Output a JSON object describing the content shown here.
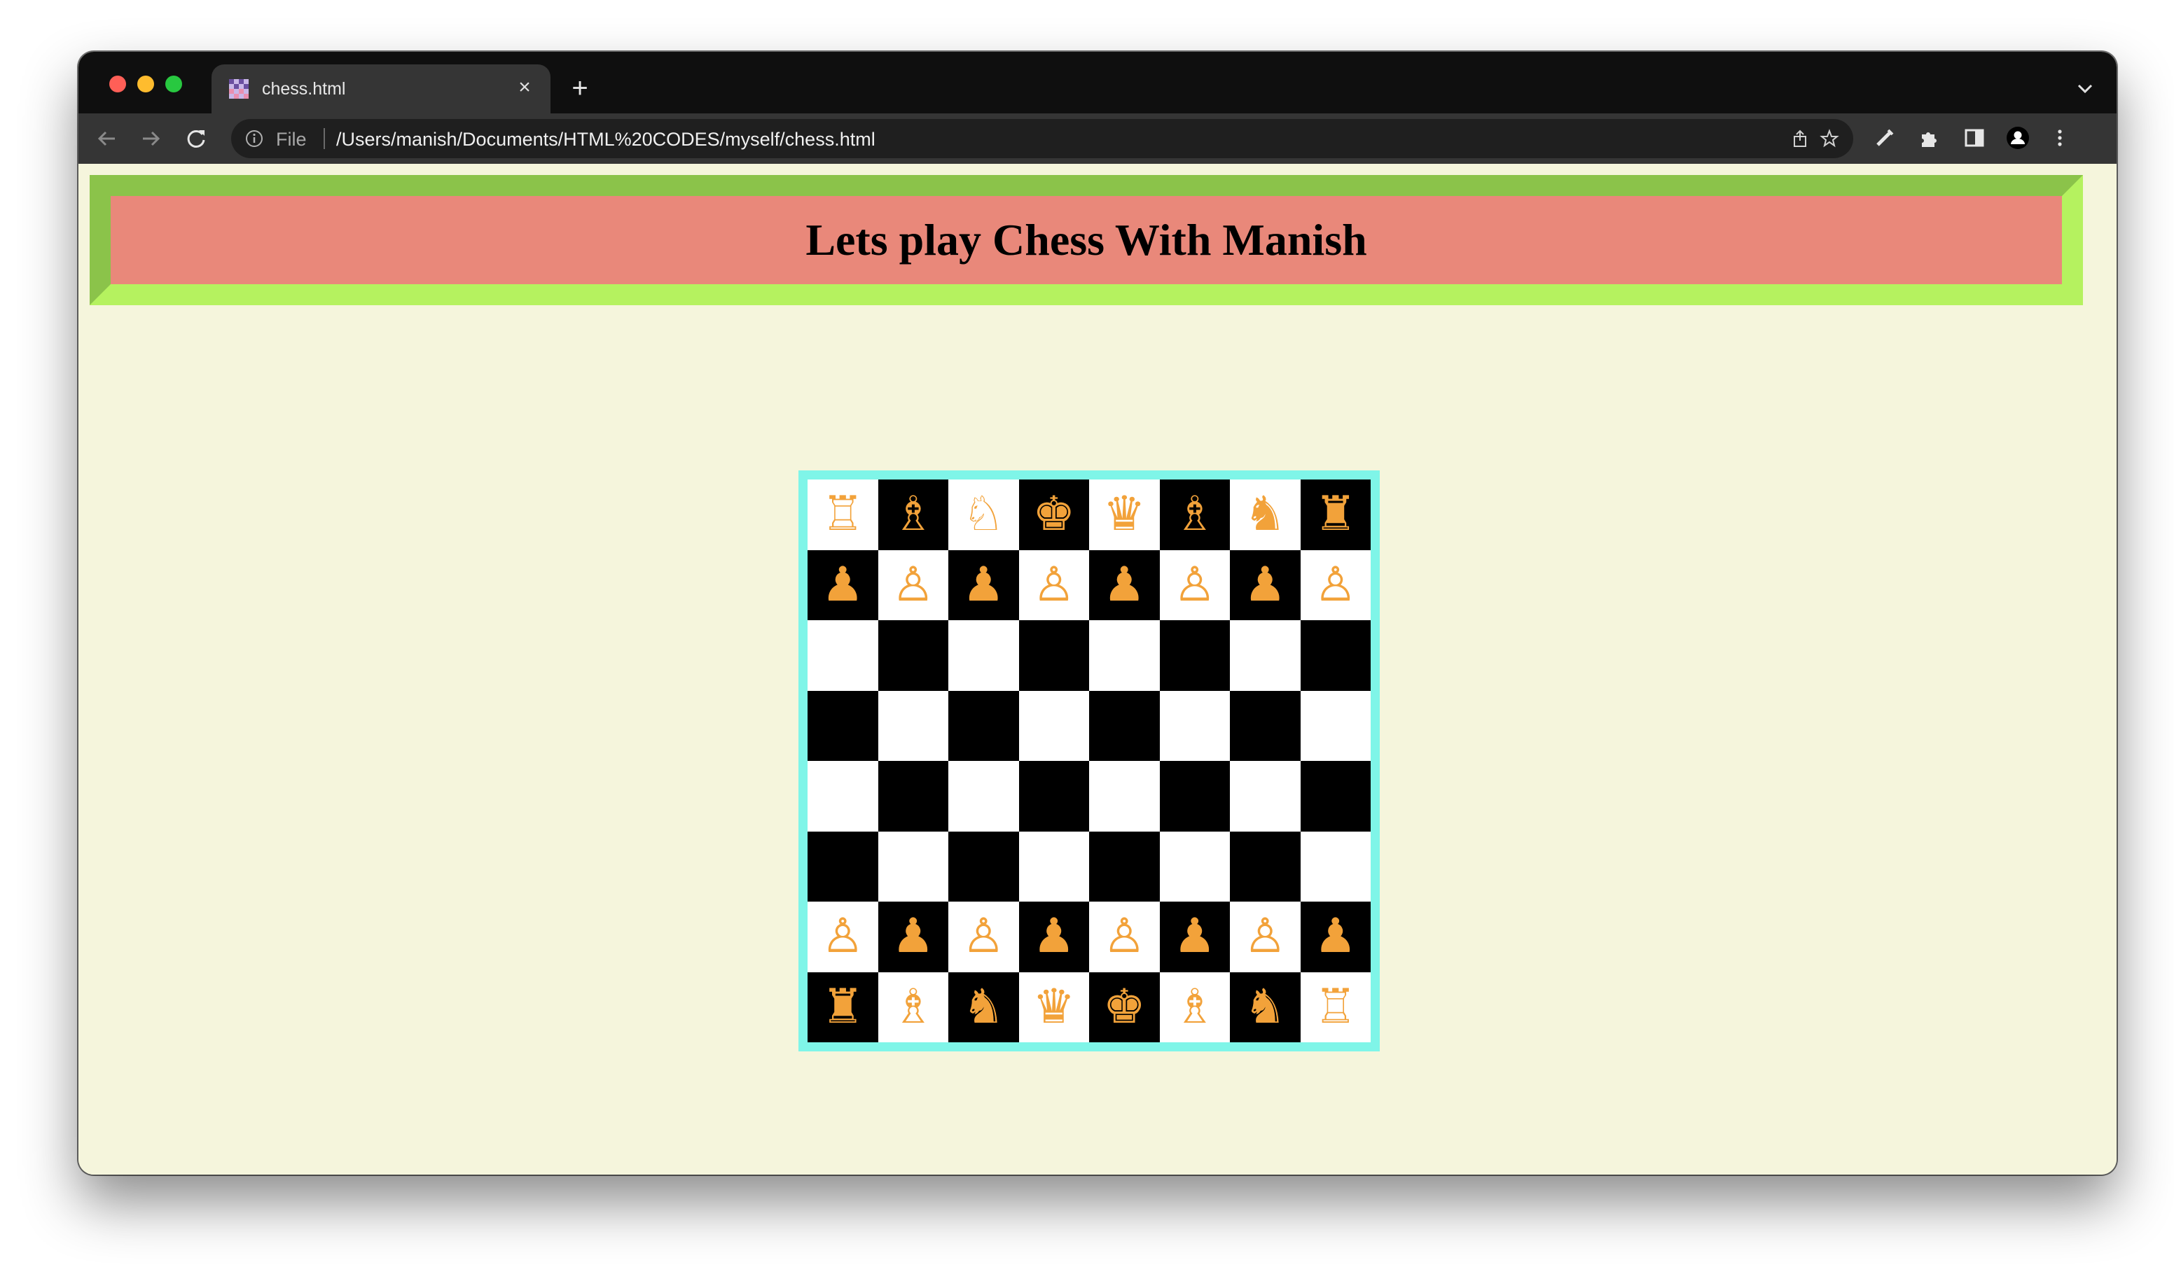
{
  "browser": {
    "tab": {
      "title": "chess.html",
      "favicon": "chess-favicon",
      "close_icon": "close-icon"
    },
    "new_tab_icon": "plus-icon",
    "address": {
      "scheme_label": "File",
      "url": "/Users/manish/Documents/HTML%20CODES/myself/chess.html"
    },
    "toolbar_icons": [
      "back-icon",
      "forward-icon",
      "reload-icon",
      "info-icon",
      "share-icon",
      "star-icon",
      "pen-icon",
      "puzzle-icon",
      "sidebar-icon",
      "profile-icon",
      "kebab-menu-icon"
    ]
  },
  "page": {
    "title": "Lets play Chess With Manish",
    "background": "#f5f5dc",
    "header_background": "#e9887a"
  },
  "board": {
    "rows": [
      [
        "♖",
        "♗",
        "♘",
        "♚",
        "♛",
        "♗",
        "♞",
        "♜"
      ],
      [
        "♟",
        "♙",
        "♟",
        "♙",
        "♟",
        "♙",
        "♟",
        "♙"
      ],
      [
        "",
        "",
        "",
        "",
        "",
        "",
        "",
        ""
      ],
      [
        "",
        "",
        "",
        "",
        "",
        "",
        "",
        ""
      ],
      [
        "",
        "",
        "",
        "",
        "",
        "",
        "",
        ""
      ],
      [
        "",
        "",
        "",
        "",
        "",
        "",
        "",
        ""
      ],
      [
        "♙",
        "♟",
        "♙",
        "♟",
        "♙",
        "♟",
        "♙",
        "♟"
      ],
      [
        "♜",
        "♗",
        "♞",
        "♛",
        "♚",
        "♗",
        "♞",
        "♖"
      ]
    ],
    "piece_color": "#f2a23a",
    "border_color": "#7ff5e8",
    "light_color": "#ffffff",
    "dark_color": "#000000"
  }
}
